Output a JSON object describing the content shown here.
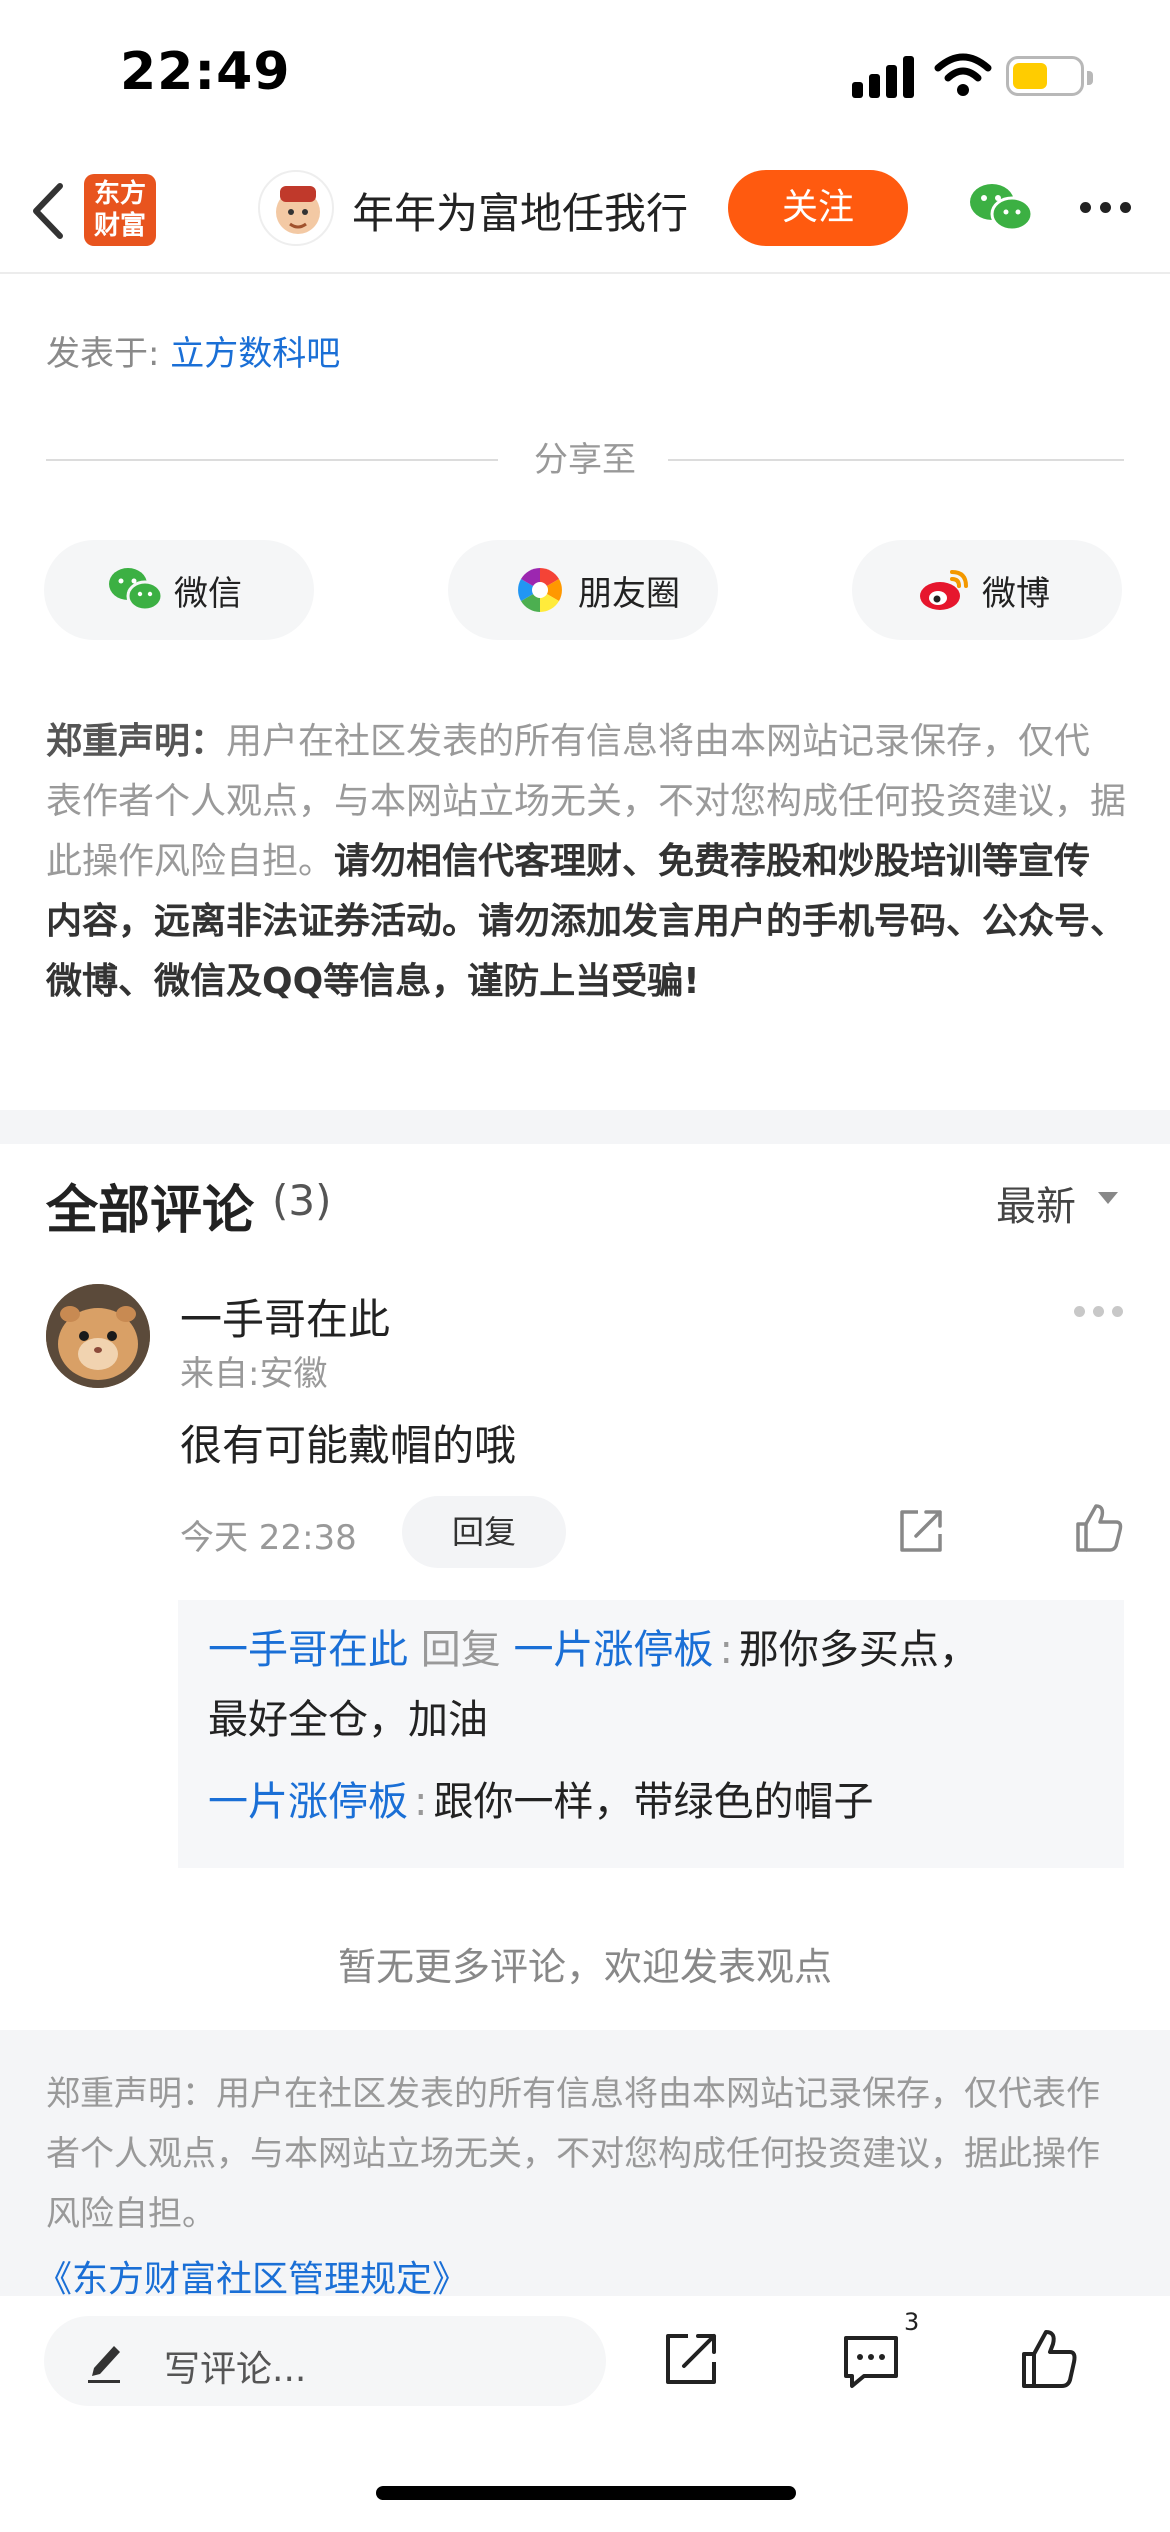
{
  "status_bar": {
    "time": "22:49"
  },
  "header": {
    "logo_text": "东方财富",
    "username": "年年为富地任我行",
    "follow_label": "关注"
  },
  "post": {
    "posted_in_label": "发表于:",
    "posted_in_bar": "立方数科吧"
  },
  "share": {
    "title": "分享至",
    "items": [
      {
        "label": "微信",
        "icon": "wechat-icon"
      },
      {
        "label": "朋友圈",
        "icon": "moments-icon"
      },
      {
        "label": "微博",
        "icon": "weibo-icon"
      }
    ]
  },
  "disclaimer": {
    "heading": "郑重声明：",
    "normal": "用户在社区发表的所有信息将由本网站记录保存，仅代表作者个人观点，与本网站立场无关，不对您构成任何投资建议，据此操作风险自担。",
    "bold": "请勿相信代客理财、免费荐股和炒股培训等宣传内容，远离非法证券活动。请勿添加发言用户的手机号码、公众号、微博、微信及QQ等信息，谨防上当受骗!"
  },
  "comments": {
    "title": "全部评论",
    "count": "(3)",
    "sort_label": "最新",
    "items": [
      {
        "name": "一手哥在此",
        "from": "来自:安徽",
        "text": "很有可能戴帽的哦",
        "time": "今天 22:38",
        "reply_label": "回复",
        "replies": [
          {
            "from": "一手哥在此",
            "reply_word": "回复",
            "to": "一片涨停板",
            "colon": ":",
            "text_line1": "那你多买点，",
            "text_line2": "最好全仓，加油"
          },
          {
            "from": "一片涨停板",
            "colon": ":",
            "text": "跟你一样，带绿色的帽子"
          }
        ]
      }
    ],
    "no_more": "暂无更多评论，欢迎发表观点"
  },
  "footer_disclaimer": {
    "text": "郑重声明：用户在社区发表的所有信息将由本网站记录保存，仅代表作者个人观点，与本网站立场无关，不对您构成任何投资建议，据此操作风险自担。",
    "link": "《东方财富社区管理规定》"
  },
  "bottom_bar": {
    "write_placeholder": "写评论...",
    "comment_badge": "3"
  },
  "colors": {
    "accent": "#ff5a0f",
    "link": "#1a6fd6"
  }
}
